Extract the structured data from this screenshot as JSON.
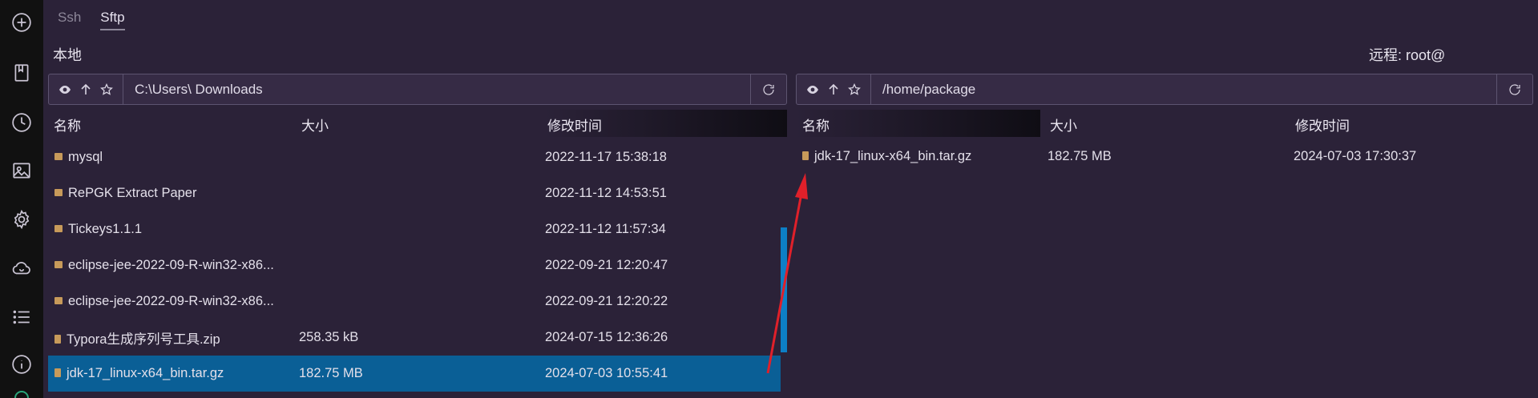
{
  "tabs": [
    {
      "label": "Ssh",
      "active": false
    },
    {
      "label": "Sftp",
      "active": true
    }
  ],
  "local": {
    "title": "本地",
    "path": "C:\\Users\\       Downloads",
    "columns": {
      "name": "名称",
      "size": "大小",
      "modified": "修改时间"
    },
    "rows": [
      {
        "icon": "folder-icon",
        "name": "mysql",
        "size": "",
        "modified": "2022-11-17 15:38:18"
      },
      {
        "icon": "folder-icon",
        "name": "RePGK Extract Paper",
        "size": "",
        "modified": "2022-11-12 14:53:51"
      },
      {
        "icon": "folder-icon",
        "name": "Tickeys1.1.1",
        "size": "",
        "modified": "2022-11-12 11:57:34"
      },
      {
        "icon": "folder-icon",
        "name": "eclipse-jee-2022-09-R-win32-x86...",
        "size": "",
        "modified": "2022-09-21 12:20:47"
      },
      {
        "icon": "folder-icon",
        "name": "eclipse-jee-2022-09-R-win32-x86...",
        "size": "",
        "modified": "2022-09-21 12:20:22"
      },
      {
        "icon": "file-icon",
        "name": "Typora生成序列号工具.zip",
        "size": "258.35 kB",
        "modified": "2024-07-15 12:36:26"
      },
      {
        "icon": "file-icon",
        "name": "jdk-17_linux-x64_bin.tar.gz",
        "size": "182.75 MB",
        "modified": "2024-07-03 10:55:41",
        "selected": true
      }
    ]
  },
  "remote": {
    "title": "远程: root@",
    "path": "/home/package",
    "columns": {
      "name": "名称",
      "size": "大小",
      "modified": "修改时间"
    },
    "rows": [
      {
        "icon": "file-icon",
        "name": "jdk-17_linux-x64_bin.tar.gz",
        "size": "182.75 MB",
        "modified": "2024-07-03 17:30:37"
      }
    ]
  },
  "colors": {
    "background": "#2b2238",
    "rail": "#111111",
    "selection": "#0a5f96",
    "scrollbar": "#0d7fc6",
    "annotation_arrow": "#e0202a"
  }
}
